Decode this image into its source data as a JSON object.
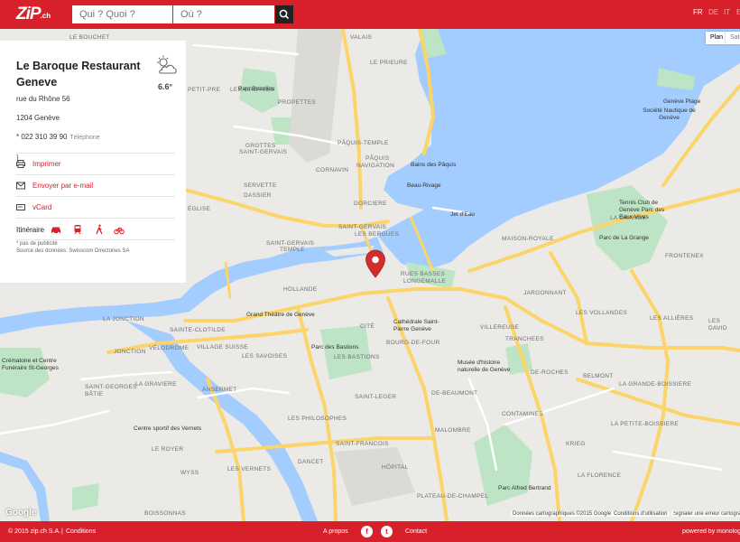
{
  "header": {
    "logo_text": "ZiP",
    "logo_suffix": ".ch",
    "search_what_placeholder": "Qui ? Quoi ?",
    "search_where_placeholder": "Où ?",
    "languages": [
      "FR",
      "DE",
      "IT",
      "EN"
    ],
    "active_language": "FR"
  },
  "map": {
    "type_buttons": [
      "Plan",
      "Satellite"
    ],
    "attribution": [
      "Données cartographiques ©2015 Google",
      "Conditions d'utilisation",
      "Signaler une erreur cartographique"
    ],
    "google": "Google",
    "labels": [
      {
        "t": "LE BOUCHET",
        "c": "dark"
      },
      {
        "t": "VALAIS",
        "c": "dark"
      },
      {
        "t": "LE PRIEURE",
        "c": "dark"
      },
      {
        "t": "PETIT-PRE",
        "c": "dark"
      },
      {
        "t": "LES GROTTES",
        "c": "dark"
      },
      {
        "t": "PROPETTES",
        "c": "dark"
      },
      {
        "t": "GROTTES",
        "c": "dark"
      },
      {
        "t": "SAINT-GERVAIS",
        "c": "dark"
      },
      {
        "t": "PÂQUIS-TEMPLE",
        "c": "dark"
      },
      {
        "t": "PÂQUIS",
        "c": "dark"
      },
      {
        "t": "NAVIGATION",
        "c": "dark"
      },
      {
        "t": "CORNAVIN",
        "c": "dark"
      },
      {
        "t": "SERVETTE",
        "c": "dark"
      },
      {
        "t": "DASSIER",
        "c": "dark"
      },
      {
        "t": "DORCIERE",
        "c": "dark"
      },
      {
        "t": "ÉGLISE",
        "c": "dark"
      },
      {
        "t": "SAINT-GERVAIS",
        "c": "dark"
      },
      {
        "t": "LES BERGUES",
        "c": "dark"
      },
      {
        "t": "SAINT-GERVAIS",
        "c": "dark"
      },
      {
        "t": "TEMPLE",
        "c": "dark"
      },
      {
        "t": "RUES BASSES",
        "c": "dark"
      },
      {
        "t": "LONGEMALLE",
        "c": "dark"
      },
      {
        "t": "HOLLANDE",
        "c": "dark"
      },
      {
        "t": "LA JONCTION",
        "c": "dark"
      },
      {
        "t": "SAINTE-CLOTILDE",
        "c": "dark"
      },
      {
        "t": "VILLAGE SUISSE",
        "c": "dark"
      },
      {
        "t": "VÉLODROME",
        "c": "dark"
      },
      {
        "t": "JONCTION",
        "c": "dark"
      },
      {
        "t": "LES SAVOISES",
        "c": "dark"
      },
      {
        "t": "LES BASTIONS",
        "c": "dark"
      },
      {
        "t": "CITÉ",
        "c": "dark"
      },
      {
        "t": "BOURG-DE-FOUR",
        "c": "dark"
      },
      {
        "t": "ANSERMET",
        "c": "dark"
      },
      {
        "t": "SAINT-LEGER",
        "c": "dark"
      },
      {
        "t": "DE-BEAUMONT",
        "c": "dark"
      },
      {
        "t": "LES PHILOSOPHES",
        "c": "dark"
      },
      {
        "t": "SAINT-GEORGES",
        "c": "dark"
      },
      {
        "t": "BÂTIE",
        "c": "dark"
      },
      {
        "t": "LA GRAVIERE",
        "c": "dark"
      },
      {
        "t": "LE ROYER",
        "c": "dark"
      },
      {
        "t": "WYSS",
        "c": "dark"
      },
      {
        "t": "LES VERNETS",
        "c": "dark"
      },
      {
        "t": "DANCET",
        "c": "dark"
      },
      {
        "t": "SAINT-FRANCOIS",
        "c": "dark"
      },
      {
        "t": "HÔPITAL",
        "c": "dark"
      },
      {
        "t": "MALOMBRE",
        "c": "dark"
      },
      {
        "t": "CONTAMINES",
        "c": "dark"
      },
      {
        "t": "KRIEG",
        "c": "dark"
      },
      {
        "t": "BOISSONNAS",
        "c": "dark"
      },
      {
        "t": "PLATEAU-DE-CHAMPEL",
        "c": "dark"
      },
      {
        "t": "LA FLORENCE",
        "c": "dark"
      },
      {
        "t": "LA PETITE-BOISSIERE",
        "c": "dark"
      },
      {
        "t": "LA GRANDE-BOISSIERE",
        "c": "dark"
      },
      {
        "t": "BELMONT",
        "c": "dark"
      },
      {
        "t": "DE-ROCHES",
        "c": "dark"
      },
      {
        "t": "VILLEREUSE",
        "c": "dark"
      },
      {
        "t": "LES VOLLANDES",
        "c": "dark"
      },
      {
        "t": "LES ALLIÈRES",
        "c": "dark"
      },
      {
        "t": "TRANCHEES",
        "c": "dark"
      },
      {
        "t": "JARGONNANT",
        "c": "dark"
      },
      {
        "t": "FRONTENEX",
        "c": "dark"
      },
      {
        "t": "MAISON-ROYALE",
        "c": "dark"
      },
      {
        "t": "LA GRANGE",
        "c": "dark"
      },
      {
        "t": "LES",
        "c": "dark"
      },
      {
        "t": "DAVID",
        "c": "dark"
      }
    ],
    "pois": [
      {
        "t": "Parc Beaulieu"
      },
      {
        "t": "Bains des Pâquis"
      },
      {
        "t": "Beau-Rivage"
      },
      {
        "t": "Jet d'Eau"
      },
      {
        "t": "Genève Plage"
      },
      {
        "t": "Société Nautique de Genève"
      },
      {
        "t": "Tennis Club de Genève Parc des Eaux-Vives"
      },
      {
        "t": "Parc de La Grange"
      },
      {
        "t": "Grand Théâtre de Genève"
      },
      {
        "t": "Cathédrale Saint-Pierre Genève"
      },
      {
        "t": "Parc des Bastions"
      },
      {
        "t": "Musée d'histoire naturelle de Genève"
      },
      {
        "t": "Crématoire et Centre Funéraire St-Georges"
      },
      {
        "t": "Centre sportif des Vernets"
      },
      {
        "t": "Parc Alfred Bertrand"
      }
    ]
  },
  "panel": {
    "title": "Le Baroque Restaurant Geneve",
    "temperature": "6.6°",
    "street": "rue du Rhône 56",
    "city": "1204 Genève",
    "phone": "* 022 310 39 90",
    "phone_label": "Téléphone",
    "actions": [
      "Imprimer",
      "Envoyer par e-mail",
      "vCard"
    ],
    "itinerary_label": "Itinéraire",
    "note1": "* pas de publicité",
    "note2": "Source des données: Swisscom Directories SA"
  },
  "footer": {
    "copyright": "© 2015 zip.ch S.A.",
    "conditions": "Conditions",
    "apropos": "A propos",
    "contact": "Contact",
    "powered": "powered by monolog"
  },
  "colors": {
    "brand_red": "#d8202a",
    "water": "#a3ccff",
    "park": "#bde4c4",
    "road_major": "#fbd569"
  }
}
